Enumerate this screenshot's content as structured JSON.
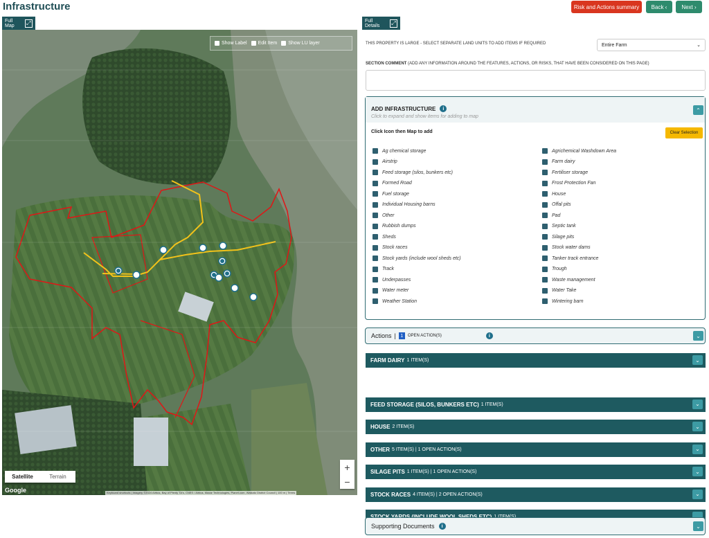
{
  "page": {
    "title": "Infrastructure"
  },
  "header_buttons": {
    "risk": "Risk and Actions summary",
    "back": "Back",
    "next": "Next"
  },
  "map_panel": {
    "tab_label": "Full Map",
    "controls": [
      {
        "label": "Show Label"
      },
      {
        "label": "Edit Item"
      },
      {
        "label": "Show LU layer"
      }
    ],
    "map_types": {
      "satellite": "Satellite",
      "terrain": "Terrain"
    },
    "zoom_in": "+",
    "zoom_out": "−",
    "google": "Google",
    "attribution": "Keyboard shortcuts | Imagery ©2024 Airbus, Bay of Plenty TA's, CNES / Airbus, Maxar Technologies, Planet.com, Waikato District Council | 100 m | Terms"
  },
  "details_panel": {
    "tab_label": "Full Details",
    "land_unit_label": "THIS PROPERTY IS LARGE - SELECT SEPARATE LAND UNITS TO ADD ITEMS IF REQUIRED",
    "land_unit_value": "Entire Farm",
    "comment_label": "SECTION COMMENT",
    "comment_hint": "(ADD ANY INFORMATION AROUND THE FEATURES, ACTIONS, OR RISKS, THAT HAVE BEEN CONSIDERED ON THIS PAGE)",
    "add_infra": {
      "title": "ADD INFRASTRUCTURE",
      "subtitle": "Click to expand and show items for adding to map",
      "click_hint": "Click Icon then Map to add",
      "clear_button": "Clear Selection",
      "left_items": [
        "Ag chemical storage",
        "Airstrip",
        "Feed storage (silos, bunkers etc)",
        "Formed Road",
        "Fuel storage",
        "Individual Housing barns",
        "Other",
        "Rubbish dumps",
        "Sheds",
        "Stock races",
        "Stock yards (include wool sheds etc)",
        "Track",
        "Underpasses",
        "Water meter",
        "Weather Station"
      ],
      "right_items": [
        "Agrichemical Washdown Area",
        "Farm dairy",
        "Fertiliser storage",
        "Frost Protection Fan",
        "House",
        "Offal pits",
        "Pad",
        "Septic tank",
        "Silage pits",
        "Stock water dams",
        "Tanker track entrance",
        "Trough",
        "Waste management",
        "Water Take",
        "Wintering barn"
      ]
    },
    "actions": {
      "label": "Actions",
      "separator": "|",
      "count": "1",
      "suffix": "OPEN ACTION(S)"
    },
    "bands": [
      {
        "name": "FARM DAIRY",
        "meta": "1 ITEM(S)"
      },
      {
        "name": "FEED STORAGE (SILOS, BUNKERS ETC)",
        "meta": "1 ITEM(S)"
      },
      {
        "name": "HOUSE",
        "meta": "2 ITEM(S)"
      },
      {
        "name": "OTHER",
        "meta": "5 ITEM(S) | 1 OPEN ACTION(S)"
      },
      {
        "name": "SILAGE PITS",
        "meta": "1 ITEM(S) | 1 OPEN ACTION(S)"
      },
      {
        "name": "STOCK RACES",
        "meta": "4 ITEM(S) | 2 OPEN ACTION(S)"
      },
      {
        "name": "STOCK YARDS (INCLUDE WOOL SHEDS ETC)",
        "meta": "1 ITEM(S)"
      }
    ],
    "supporting_docs": "Supporting Documents"
  }
}
